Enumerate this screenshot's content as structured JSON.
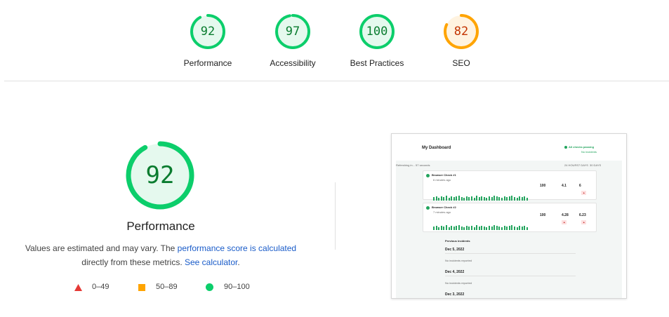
{
  "gauges": [
    {
      "score": "92",
      "label": "Performance",
      "color": "#0cce6b",
      "text_color": "#0a7c2f",
      "fraction": 0.92
    },
    {
      "score": "97",
      "label": "Accessibility",
      "color": "#0cce6b",
      "text_color": "#0a7c2f",
      "fraction": 0.97
    },
    {
      "score": "100",
      "label": "Best Practices",
      "color": "#0cce6b",
      "text_color": "#0a7c2f",
      "fraction": 1.0
    },
    {
      "score": "82",
      "label": "SEO",
      "color": "#ffa400",
      "text_color": "#c33300",
      "fraction": 0.82
    }
  ],
  "main": {
    "score": "92",
    "fraction": 0.92,
    "title": "Performance",
    "desc_pre": "Values are estimated and may vary. The ",
    "desc_link1": "performance score is calculated",
    "desc_mid": " directly from these metrics. ",
    "desc_link2": "See calculator",
    "desc_post": "."
  },
  "legend": [
    {
      "range": "0–49",
      "icon": "triangle-icon",
      "color": "#e53935"
    },
    {
      "range": "50–89",
      "icon": "square-icon",
      "color": "#ffa400"
    },
    {
      "range": "90–100",
      "icon": "circle-icon",
      "color": "#0cce6b"
    }
  ],
  "thumb": {
    "title": "My Dashboard",
    "status": "All checks passing",
    "status_sub": "No incidents",
    "refresh": "Refreshing in... 57 seconds",
    "ranges": [
      "24 HOURS",
      "7 DAYS",
      "30 DAYS"
    ],
    "checks": [
      {
        "name": "Browser Check #1",
        "ago": "6 minutes ago",
        "m1": "100",
        "m2": "4.1",
        "m3": "6"
      },
      {
        "name": "Browser Check #2",
        "ago": "7 minutes ago",
        "m1": "100",
        "m2": "4.28",
        "m3": "6.23"
      }
    ],
    "incidents_title": "Previous incidents",
    "incidents": [
      {
        "date": "Dec 5, 2022",
        "note": "No incidents reported"
      },
      {
        "date": "Dec 4, 2022",
        "note": "No incidents reported"
      },
      {
        "date": "Dec 3, 2022",
        "note": ""
      }
    ]
  }
}
